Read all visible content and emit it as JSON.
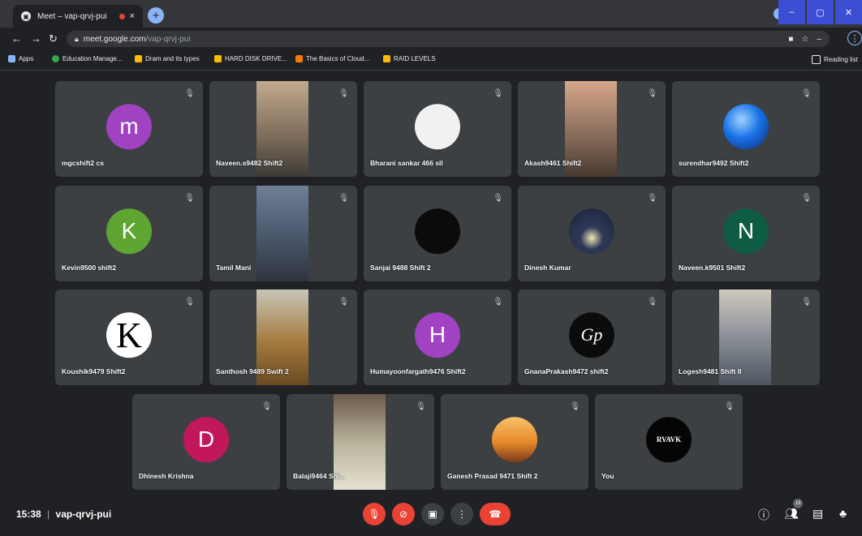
{
  "browser": {
    "tab_title": "Meet – vap-qrvj-pui",
    "tab_close": "×",
    "new_tab": "+",
    "url_host": "meet.google.com",
    "url_path": "/vap-qrvj-pui",
    "reading_list": "Reading list",
    "bookmarks": [
      {
        "label": "Apps",
        "color": "#8ab4f8"
      },
      {
        "label": "Education Manage...",
        "color": "#34a853"
      },
      {
        "label": "Dram and its types",
        "color": "#fbbc04"
      },
      {
        "label": "HARD DISK DRIVE...",
        "color": "#fbbc04"
      },
      {
        "label": "The Basics of Cloud...",
        "color": "#f57c00"
      },
      {
        "label": "RAID LEVELS",
        "color": "#fbbc04"
      }
    ]
  },
  "participants": [
    {
      "name": "mgcshift2 cs",
      "type": "avatar",
      "letter": "m",
      "color": "#a142c2"
    },
    {
      "name": "Naveen.s9482 Shift2",
      "type": "video",
      "color": "#7a6a58"
    },
    {
      "name": "Bharani sankar 466 sll",
      "type": "avatar",
      "letter": "",
      "color": "#f1f1f1"
    },
    {
      "name": "Akash9461 Shift2",
      "type": "video",
      "color": "#8a6e5c"
    },
    {
      "name": "surendhar9492 Shift2",
      "type": "avatar",
      "letter": "",
      "color": "#1a73e8"
    },
    {
      "name": "Kevin9500 shift2",
      "type": "avatar",
      "letter": "K",
      "color": "#5fa532"
    },
    {
      "name": "Tamil Mani",
      "type": "video",
      "color": "#4c5a6e"
    },
    {
      "name": "Sanjai 9488 Shift 2",
      "type": "avatar",
      "letter": "",
      "color": "#0b0b0b"
    },
    {
      "name": "Dinesh Kumar",
      "type": "avatar",
      "letter": "",
      "color": "#2e3a58"
    },
    {
      "name": "Naveen.k9501 Shift2",
      "type": "avatar",
      "letter": "N",
      "color": "#0e5c43"
    },
    {
      "name": "Koushik9479 Shift2",
      "type": "avatar",
      "letter": "K",
      "color": "#ffffff"
    },
    {
      "name": "Santhosh 9489 Swift 2",
      "type": "video",
      "color": "#a47a3c"
    },
    {
      "name": "Humayoonfargath9476 Shift2",
      "type": "avatar",
      "letter": "H",
      "color": "#a142c2"
    },
    {
      "name": "GnanaPrakash9472 shift2",
      "type": "avatar",
      "letter": "Gp",
      "color": "#0b0b0b"
    },
    {
      "name": "Logesh9481 Shift II",
      "type": "video",
      "color": "#8a8f96"
    },
    {
      "name": "Dhinesh Krishna",
      "type": "avatar",
      "letter": "D",
      "color": "#c2185b"
    },
    {
      "name": "Balaji9464 Shi...",
      "type": "video",
      "color": "#b8b29a"
    },
    {
      "name": "Ganesh Prasad 9471 Shift 2",
      "type": "avatar",
      "letter": "",
      "color": "#e88a2a"
    },
    {
      "name": "You",
      "type": "avatar",
      "letter": "RVAVK",
      "color": "#050505"
    }
  ],
  "bottom": {
    "time": "15:38",
    "separator": "|",
    "meeting_code": "vap-qrvj-pui",
    "participant_count": "19",
    "hangup_color": "#ea4335"
  }
}
